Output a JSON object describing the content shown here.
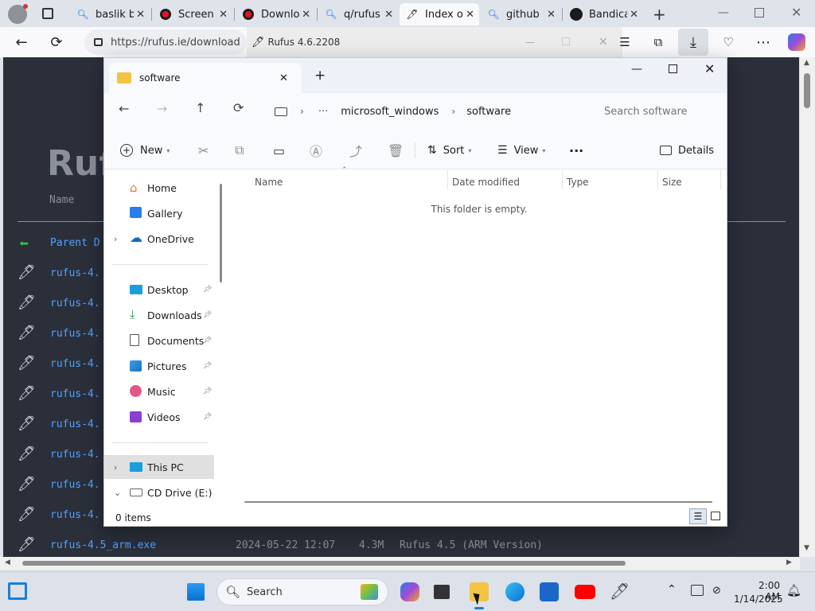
{
  "browser": {
    "tabs": [
      {
        "title": "baslik b",
        "icon": "search-icon"
      },
      {
        "title": "Screen",
        "icon": "record-icon"
      },
      {
        "title": "Downlo",
        "icon": "record-icon"
      },
      {
        "title": "q/rufus",
        "icon": "search-icon"
      },
      {
        "title": "Index o",
        "icon": "usb-drive-icon"
      },
      {
        "title": "github",
        "icon": "search-icon"
      },
      {
        "title": "Bandica",
        "icon": "github-icon"
      }
    ],
    "url": "https://rufus.ie/download",
    "overlay_window_title": "Rufus 4.6.2208"
  },
  "page": {
    "heading": "Ruf",
    "column_name": "Name",
    "parent_link": "Parent D",
    "files": [
      "rufus-4.",
      "rufus-4.",
      "rufus-4.",
      "rufus-4.",
      "rufus-4.",
      "rufus-4.",
      "rufus-4.",
      "rufus-4.",
      "rufus-4."
    ],
    "last_file": {
      "name": "rufus-4.5_arm.exe",
      "date": "2024-05-22 12:07",
      "size": "4.3M",
      "desc": "Rufus 4.5 (ARM Version)"
    }
  },
  "explorer": {
    "tab_title": "software",
    "breadcrumb": [
      "microsoft_windows",
      "software"
    ],
    "breadcrumb_more": "···",
    "search_placeholder": "Search software",
    "commands": {
      "new": "New",
      "sort": "Sort",
      "view": "View",
      "more": "···",
      "details": "Details"
    },
    "nav_top": [
      {
        "label": "Home",
        "icon": "home-icon"
      },
      {
        "label": "Gallery",
        "icon": "gallery-icon"
      },
      {
        "label": "OneDrive",
        "icon": "cloud-icon"
      }
    ],
    "nav_pinned": [
      {
        "label": "Desktop",
        "icon": "desktop-icon"
      },
      {
        "label": "Downloads",
        "icon": "download-icon"
      },
      {
        "label": "Documents",
        "icon": "document-icon"
      },
      {
        "label": "Pictures",
        "icon": "pictures-icon"
      },
      {
        "label": "Music",
        "icon": "music-icon"
      },
      {
        "label": "Videos",
        "icon": "video-icon"
      }
    ],
    "nav_bottom": [
      {
        "label": "This PC",
        "icon": "computer-icon"
      },
      {
        "label": "CD Drive (E:) virt",
        "icon": "cd-drive-icon"
      }
    ],
    "columns": [
      "Name",
      "Date modified",
      "Type",
      "Size"
    ],
    "empty_message": "This folder is empty.",
    "status": "0 items"
  },
  "taskbar": {
    "search_placeholder": "Search",
    "time": "2:00 AM",
    "date": "1/14/2025"
  }
}
